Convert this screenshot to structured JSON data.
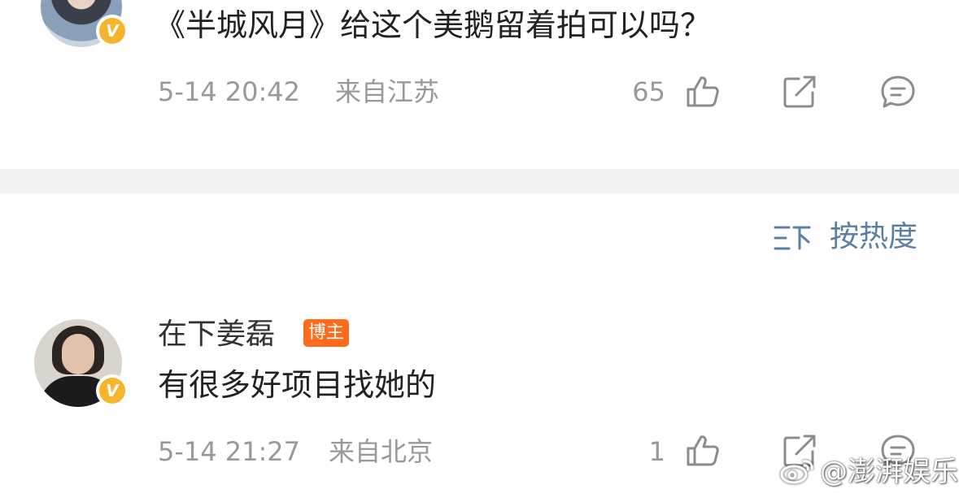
{
  "comments": [
    {
      "text": "《半城风月》给这个美鹅留着拍可以吗？",
      "time": "5-14 20:42",
      "location": "来自江苏",
      "likes": "65",
      "avatar_icon": "avatar-woman-costume",
      "verified": "V"
    },
    {
      "username": "在下姜磊",
      "badge": "博主",
      "text": "有很多好项目找她的",
      "time": "5-14 21:27",
      "location": "来自北京",
      "likes": "1",
      "avatar_icon": "avatar-man-black-shirt",
      "verified": "V"
    }
  ],
  "sort": {
    "label": "按热度",
    "icon": "sort-lines-icon"
  },
  "watermark": "@澎湃娱乐",
  "colors": {
    "accent": "#5a7ea6",
    "verified": "#f7b52b",
    "badge": "#ff6b1a",
    "meta": "#999999"
  }
}
